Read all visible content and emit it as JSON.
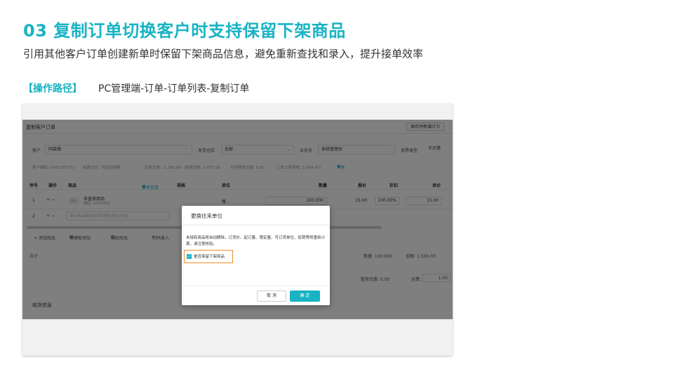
{
  "slide": {
    "title": "03 复制订单切换客户时支持保留下架商品",
    "subtitle": "引用其他客户订单创建新单时保留下架商品信息，避免重新查找和录入，提升接单效率",
    "path_label": "【操作路径】",
    "path_value": "PC管理端-订单-订单列表-复制订单"
  },
  "app": {
    "title": "复制客户订单",
    "save_button": "保存并新增(F7)",
    "fields": {
      "customer_label": "客户",
      "customer_value": "同森镇",
      "warehouse_label": "发货仓库",
      "warehouse_value": "全部",
      "salesman_label": "业务员",
      "salesman_value": "系统管理员",
      "invoice_label": "发票类型",
      "invoice_value": "不开票"
    },
    "info": {
      "code": "客户编码: 0362785772",
      "settle": "结算方式: 不固定账期",
      "arrears": "应收欠款: -1,388.89（信用总额: 2,475.58",
      "available": "可用预收总额: 0.00",
      "occupied": "订单占用预收: 3,864.47）",
      "detail_link": "详情"
    },
    "table": {
      "headers": [
        "序号",
        "操作",
        "商品",
        "单位",
        "数量",
        "报价",
        "折扣",
        "单价"
      ],
      "ref_link": "参考信息",
      "spec_header": "规格",
      "row1": {
        "index": "1",
        "ops": "+ −",
        "thumb": "图片",
        "name": "非直发商品",
        "code": "编码: 32002001",
        "unit": "瓶",
        "qty": "100.000",
        "quote": "15.00",
        "discount": "100.00%",
        "price": "15.00"
      },
      "row2": {
        "index": "2",
        "ops": "+ −",
        "placeholder": "输入商品编码/名称/规格/条码/拼音"
      }
    },
    "toolbar": {
      "add_item": "+ 添加商品",
      "template_add": "按模板添加",
      "paste_item": "粘贴商品",
      "scan_input": "扫码录入"
    },
    "totals": {
      "label": "合计",
      "qty": "数量: 100.000",
      "amount": "金额: 1,500.00"
    },
    "discount": {
      "label": "整单优惠: 0.00",
      "freight": "运费:",
      "freight_value": "1.00"
    },
    "receive_info": "收货信息"
  },
  "modal": {
    "title": "更换往来单位",
    "message": "未授权商品将自动删除，订货价、起订量、限定量、可订货单位、促销等将重新计算，请注意核验。",
    "checkbox_label": "是否保留下架商品",
    "cancel": "取 消",
    "ok": "确 定"
  },
  "colors": {
    "accent": "#18b3c4",
    "highlight": "#f08c2e"
  }
}
